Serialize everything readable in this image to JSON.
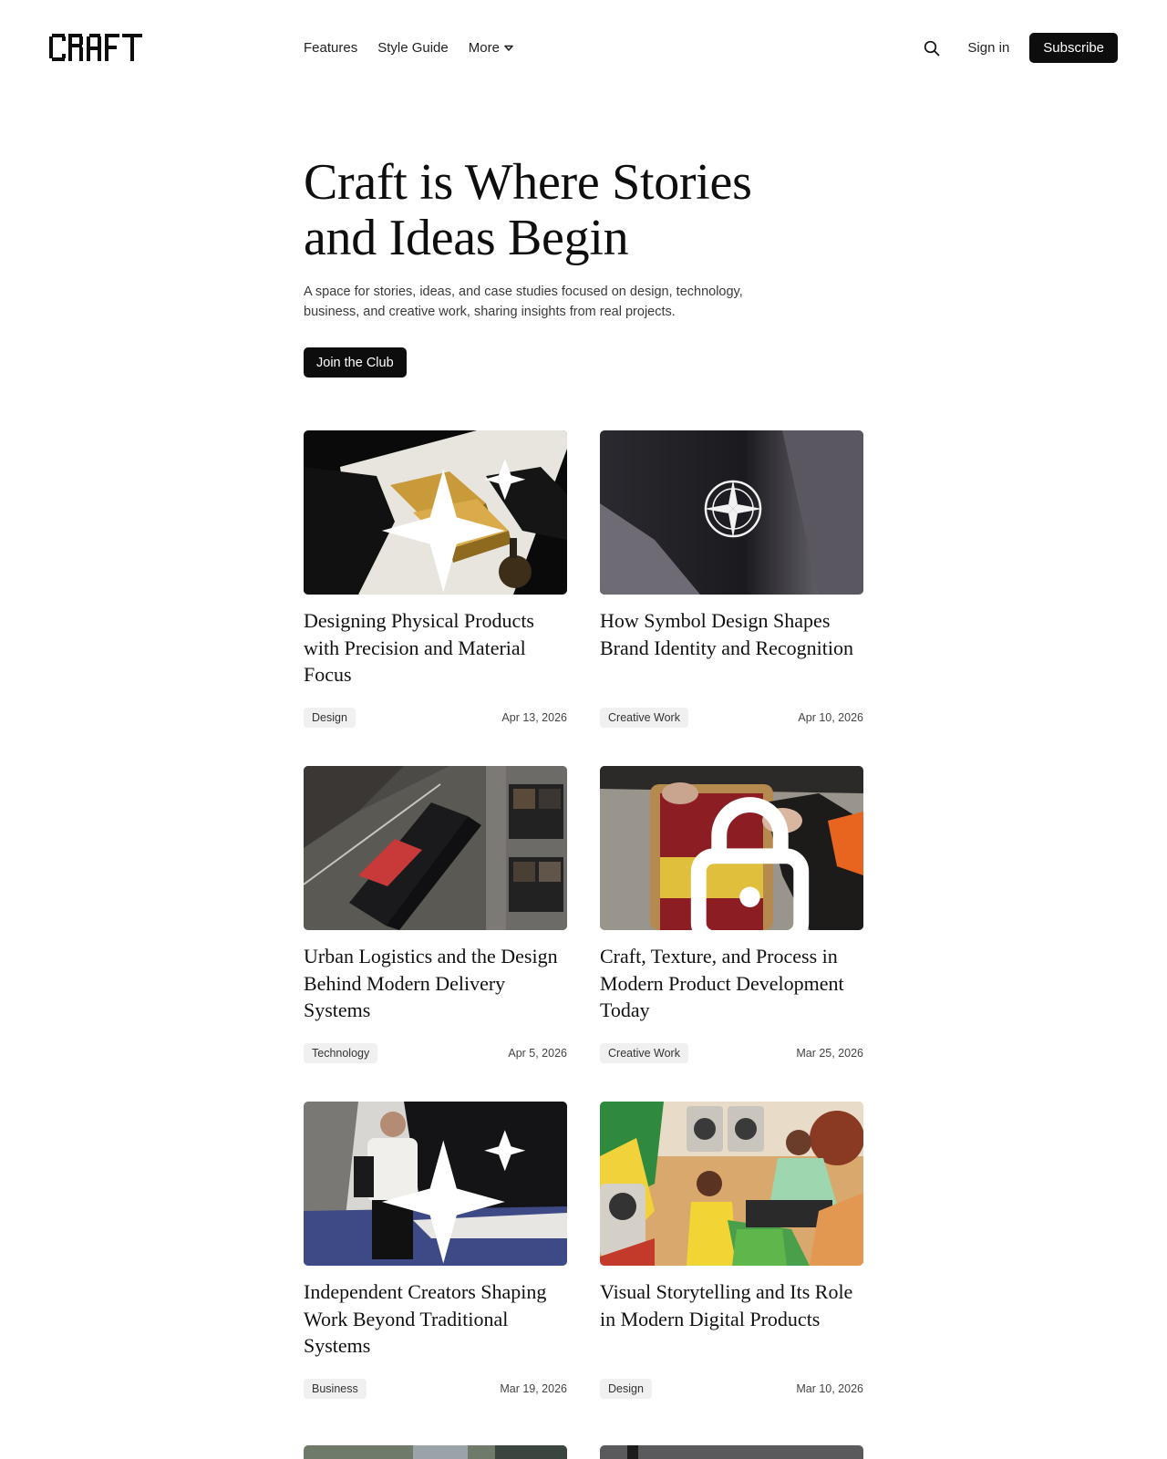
{
  "brand": {
    "logo_text": "CRAFT"
  },
  "nav": {
    "features": "Features",
    "style_guide": "Style Guide",
    "more": "More"
  },
  "header": {
    "search_icon": "search-icon",
    "sign_in": "Sign in",
    "subscribe": "Subscribe"
  },
  "hero": {
    "title_line1": "Craft is Where Stories",
    "title_line2": "and Ideas Begin",
    "subtitle": "A space for stories, ideas, and case studies focused on design, technology, business, and creative work, sharing insights from real projects.",
    "cta": "Join the Club"
  },
  "posts": [
    {
      "title": "Designing Physical Products with Precision and Material Focus",
      "tag": "Design",
      "date": "Apr 13, 2026",
      "icon": "sparkle-icon"
    },
    {
      "title": "How Symbol Design Shapes Brand Identity and Recognition",
      "tag": "Creative Work",
      "date": "Apr 10, 2026"
    },
    {
      "title": "Urban Logistics and the Design Behind Modern Delivery Systems",
      "tag": "Technology",
      "date": "Apr 5, 2026"
    },
    {
      "title": "Craft, Texture, and Process in Modern Product Development Today",
      "tag": "Creative Work",
      "date": "Mar 25, 2026",
      "icon": "lock-icon"
    },
    {
      "title": "Independent Creators Shaping Work Beyond Traditional Systems",
      "tag": "Business",
      "date": "Mar 19, 2026",
      "icon": "sparkle-icon"
    },
    {
      "title": "Visual Storytelling and Its Role in Modern Digital Products",
      "tag": "Design",
      "date": "Mar 10, 2026"
    }
  ]
}
